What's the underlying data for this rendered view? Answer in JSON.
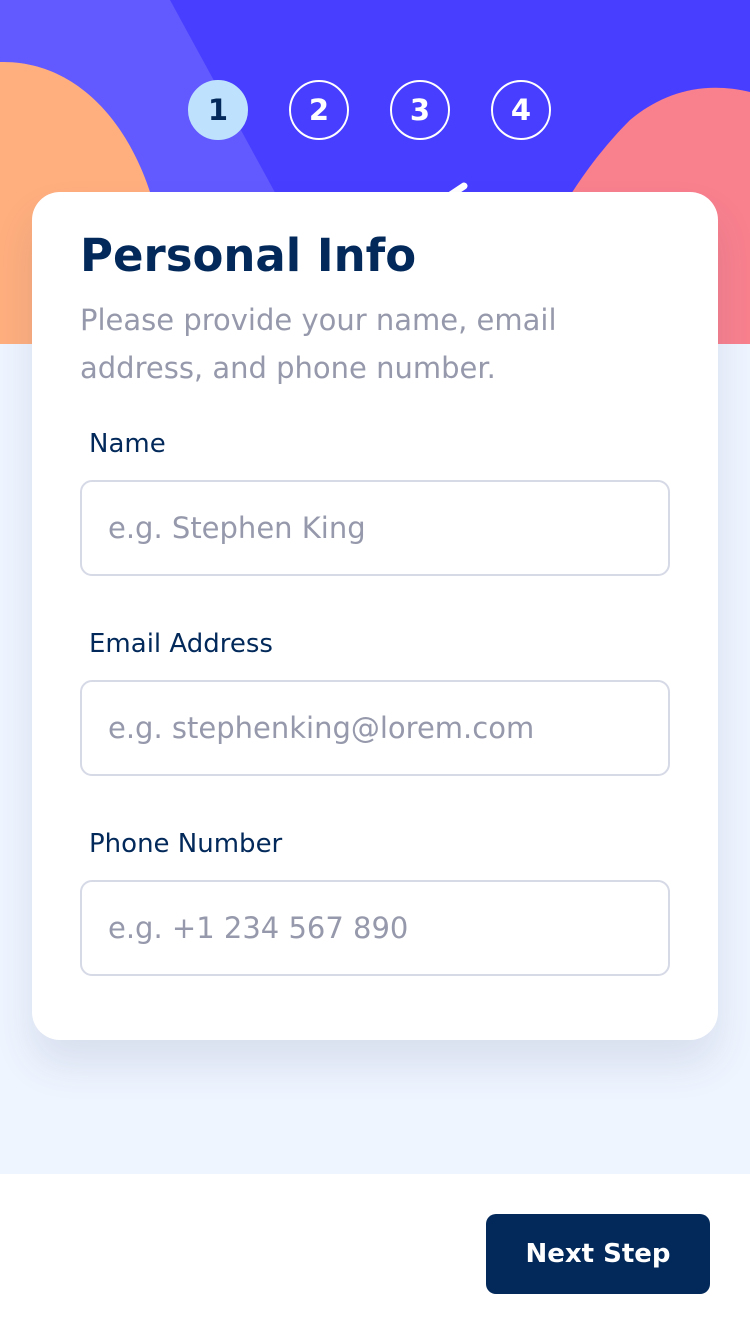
{
  "colors": {
    "marine_blue": "#02295a",
    "purplish_blue": "#483eff",
    "light_blue": "#bee2fd",
    "cool_gray": "#9699ab",
    "light_gray": "#d6d9e6",
    "magnolia": "#eff5ff",
    "orange_shape": "#ffaf7e",
    "pink_shape": "#f9818e",
    "violet_shape": "#6259ff",
    "white": "#ffffff"
  },
  "steps": [
    {
      "number": "1",
      "active": true
    },
    {
      "number": "2",
      "active": false
    },
    {
      "number": "3",
      "active": false
    },
    {
      "number": "4",
      "active": false
    }
  ],
  "form": {
    "title": "Personal Info",
    "subtitle": "Please provide your name, email address, and phone number.",
    "fields": [
      {
        "label": "Name",
        "placeholder": "e.g. Stephen King",
        "value": ""
      },
      {
        "label": "Email Address",
        "placeholder": "e.g. stephenking@lorem.com",
        "value": ""
      },
      {
        "label": "Phone Number",
        "placeholder": "e.g. +1 234 567 890",
        "value": ""
      }
    ]
  },
  "footer": {
    "next_label": "Next Step"
  }
}
